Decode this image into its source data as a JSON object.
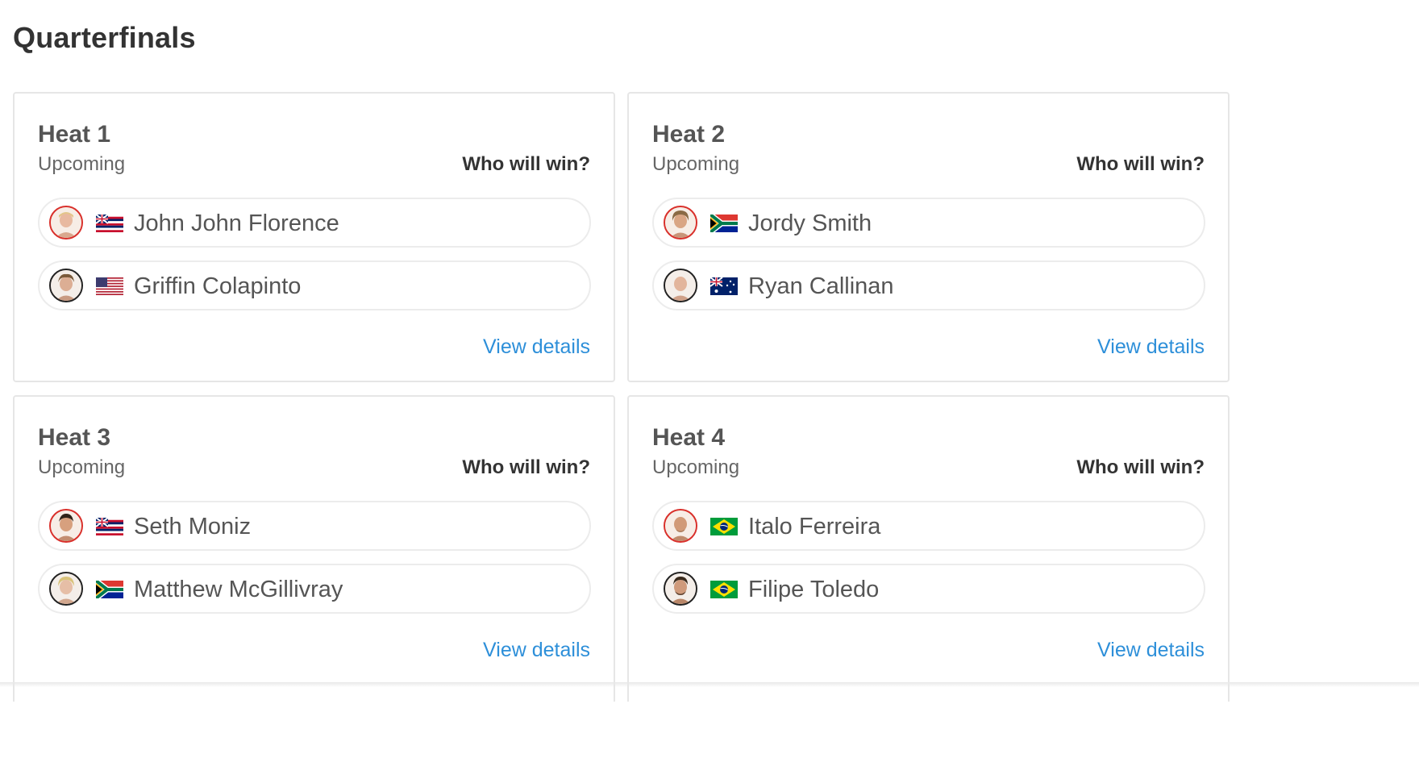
{
  "page": {
    "title": "Quarterfinals"
  },
  "heats": [
    {
      "title": "Heat 1",
      "status": "Upcoming",
      "prompt": "Who will win?",
      "link": "View details",
      "surfers": [
        {
          "name": "John John Florence",
          "flag": "hawaii-flag-icon",
          "avatar_ring": "red"
        },
        {
          "name": "Griffin Colapinto",
          "flag": "usa-flag-icon",
          "avatar_ring": "dark"
        }
      ]
    },
    {
      "title": "Heat 2",
      "status": "Upcoming",
      "prompt": "Who will win?",
      "link": "View details",
      "surfers": [
        {
          "name": "Jordy Smith",
          "flag": "south-africa-flag-icon",
          "avatar_ring": "red"
        },
        {
          "name": "Ryan Callinan",
          "flag": "australia-flag-icon",
          "avatar_ring": "dark"
        }
      ]
    },
    {
      "title": "Heat 3",
      "status": "Upcoming",
      "prompt": "Who will win?",
      "link": "View details",
      "surfers": [
        {
          "name": "Seth Moniz",
          "flag": "hawaii-flag-icon",
          "avatar_ring": "red"
        },
        {
          "name": "Matthew McGillivray",
          "flag": "south-africa-flag-icon",
          "avatar_ring": "dark"
        }
      ]
    },
    {
      "title": "Heat 4",
      "status": "Upcoming",
      "prompt": "Who will win?",
      "link": "View details",
      "surfers": [
        {
          "name": "Italo Ferreira",
          "flag": "brazil-flag-icon",
          "avatar_ring": "red"
        },
        {
          "name": "Filipe Toledo",
          "flag": "brazil-flag-icon",
          "avatar_ring": "dark"
        }
      ]
    }
  ],
  "colors": {
    "link": "#2d8fd9",
    "avatar_ring_red": "#d9302b",
    "avatar_ring_dark": "#222222",
    "card_border": "#e6e6e6"
  }
}
